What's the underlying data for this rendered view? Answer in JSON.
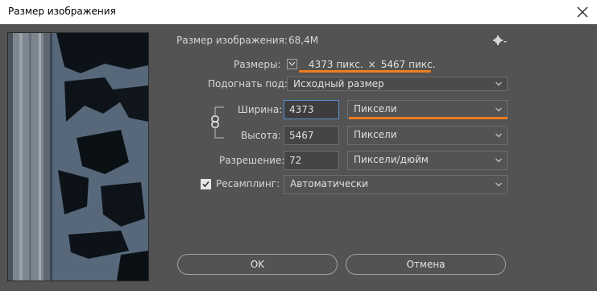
{
  "window": {
    "title": "Размер изображения"
  },
  "image_size": {
    "label": "Размер изображения:",
    "value": "68,4М"
  },
  "dimensions": {
    "label": "Размеры:",
    "width": "4373 пикс.",
    "times": "×",
    "height": "5467 пикс.",
    "checked": false
  },
  "fit_to": {
    "label": "Подогнать под:",
    "value": "Исходный размер"
  },
  "width": {
    "label": "Ширина:",
    "value": "4373",
    "unit": "Пиксели"
  },
  "height": {
    "label": "Высота:",
    "value": "5467",
    "unit": "Пиксели"
  },
  "resolution": {
    "label": "Разрешение:",
    "value": "72",
    "unit": "Пиксели/дюйм"
  },
  "resample": {
    "label": "Ресамплинг:",
    "value": "Автоматически",
    "checked": true
  },
  "buttons": {
    "ok": "OK",
    "cancel": "Отмена"
  },
  "colors": {
    "highlight": "#f07d1f",
    "focus": "#5a8fd3",
    "background": "#535353"
  },
  "icons": {
    "close": "close-icon",
    "gear": "gear-icon",
    "link": "link-icon",
    "chevron": "chevron-down-icon"
  }
}
